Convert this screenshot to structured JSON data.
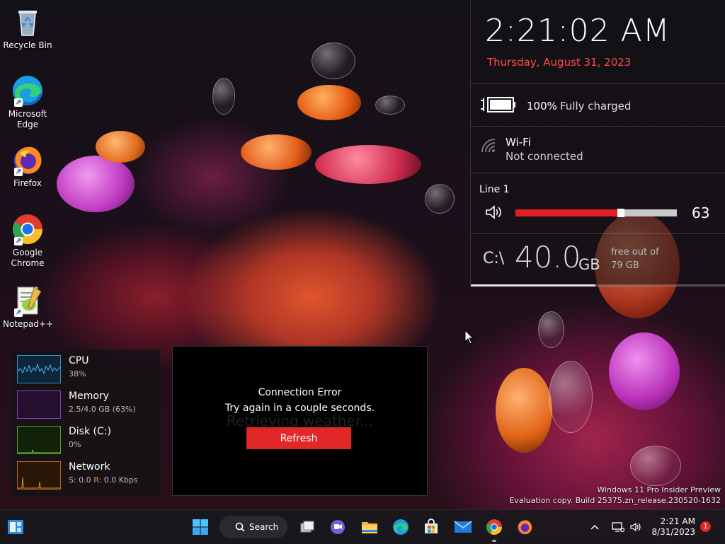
{
  "desktop": {
    "icons": [
      {
        "label": "Recycle Bin"
      },
      {
        "label": "Microsoft Edge"
      },
      {
        "label": "Firefox"
      },
      {
        "label": "Google Chrome"
      },
      {
        "label": "Notepad++"
      }
    ]
  },
  "clock_widget": {
    "time": "2:21:02 AM",
    "date": "Thursday, August 31, 2023",
    "battery": {
      "percent": "100%",
      "status": "Fully charged"
    },
    "wifi": {
      "name": "Wi-Fi",
      "status": "Not connected"
    },
    "volume": {
      "label": "Line 1",
      "value": "63",
      "level": 0.63
    },
    "disk": {
      "drive": "C:\\",
      "free": "40.0",
      "unit": "GB",
      "free_label": "free out of",
      "total": "79 GB",
      "used_fraction": 0.49
    }
  },
  "system_monitor": {
    "cpu": {
      "title": "CPU",
      "value": "38%"
    },
    "memory": {
      "title": "Memory",
      "value": "2.5/4.0 GB (63%)"
    },
    "disk": {
      "title": "Disk (C:)",
      "value": "0%"
    },
    "network": {
      "title": "Network",
      "value_s": "S: 0.0",
      "value_r_label": "R:",
      "value_r": "0.0 Kbps"
    }
  },
  "weather_widget": {
    "background_text": "Retrieving weather...",
    "error_title": "Connection Error",
    "error_message": "Try again in a couple seconds.",
    "refresh_label": "Refresh"
  },
  "watermark": {
    "line1": "Windows 11 Pro Insider Preview",
    "line2": "Evaluation copy. Build 25375.zn_release.230520-1632"
  },
  "taskbar": {
    "search_label": "Search",
    "time": "2:21 AM",
    "date": "8/31/2023",
    "notification_count": "1"
  },
  "colors": {
    "accent_red": "#e02828",
    "date_red": "#ff4a4a"
  }
}
